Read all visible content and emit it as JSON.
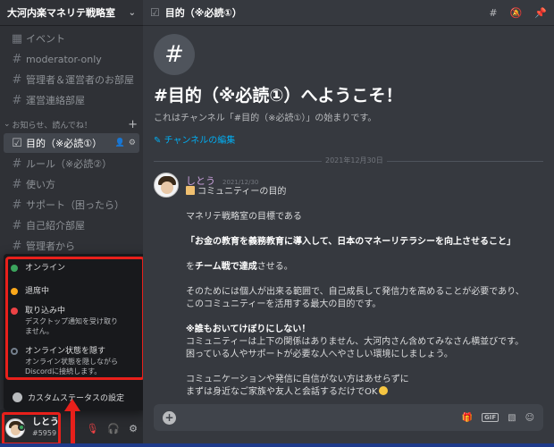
{
  "server": {
    "name": "大河内楽マネリテ戦略室"
  },
  "channels_top": [
    {
      "label": "イベント",
      "icon": "calendar-icon"
    },
    {
      "label": "moderator-only",
      "icon": "hash-icon"
    },
    {
      "label": "管理者＆運営者のお部屋",
      "icon": "hash-icon"
    },
    {
      "label": "運営連絡部屋",
      "icon": "hash-icon"
    }
  ],
  "category": {
    "label": "お知らせ、読んでね！"
  },
  "channels": [
    {
      "label": "目的（※必読①）",
      "active": true
    },
    {
      "label": "ルール（※必読②）"
    },
    {
      "label": "使い方"
    },
    {
      "label": "サポート（困ったら）"
    },
    {
      "label": "自己紹介部屋"
    },
    {
      "label": "管理者から"
    }
  ],
  "status_menu": {
    "online": {
      "label": "オンライン"
    },
    "idle": {
      "label": "退席中"
    },
    "dnd": {
      "label": "取り込み中",
      "desc": "デスクトップ通知を受け取りません。"
    },
    "invisible": {
      "label": "オンライン状態を隠す",
      "desc": "オンライン状態を隠しながらDiscordに接続します。"
    },
    "custom": {
      "label": "カスタムステータスの設定"
    }
  },
  "user": {
    "name": "しとう",
    "tag": "#5959"
  },
  "topbar": {
    "title": "目的（※必読①）"
  },
  "welcome": {
    "title": "#目的（※必読①）へようこそ！",
    "subtitle": "これはチャンネル「#目的（※必読①）」の始まりです。",
    "edit_link": "チャンネルの編集"
  },
  "date_divider": "2021年12月30日",
  "message": {
    "author": "しとう",
    "timestamp": "2021/12/30",
    "lines": {
      "l1": "コミュニティーの目的",
      "l2": "マネリテ戦略室の目標である",
      "l3": "「お金の教育を義務教育に導入して、日本のマネーリテラシーを向上させること」",
      "l4a": "を",
      "l4b": "チーム戦で達成",
      "l4c": "させる。",
      "l5": "そのためには個人が出来る範囲で、自己成長して発信力を高めることが必要であり、",
      "l6": "このコミュニティーを活用する最大の目的です。",
      "l7": "※誰もおいてけぼりにしない！",
      "l8": "コミュニティーは上下の関係はありません、大河内さん含めてみなさん横並びです。",
      "l9": "困っている人やサポートが必要な人へやさしい環境にしましょう。",
      "l10": "コミュニケーションや発信に自信がない方はあせらずに",
      "l11": "まずは身近なご家族や友人と会話するだけでOK"
    }
  },
  "composer": {
    "gif_label": "GIF"
  },
  "colors": {
    "online": "#3ba55d",
    "idle": "#faa81a",
    "dnd": "#ed4245",
    "annotation": "#e8201b",
    "link": "#00aff4"
  }
}
